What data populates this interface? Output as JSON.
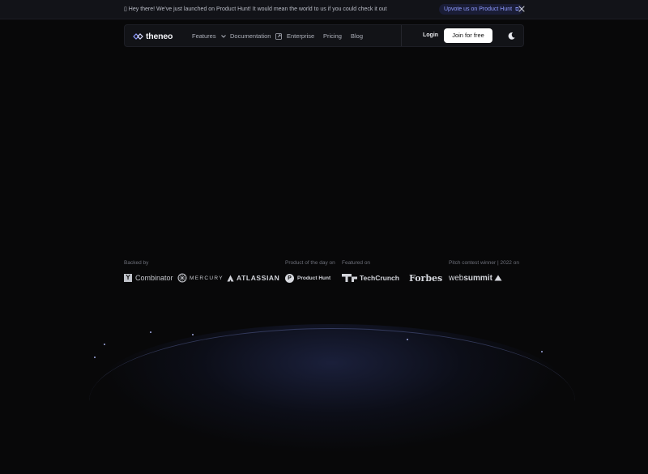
{
  "banner": {
    "text": "▯ Hey there! We've just launched on Product Hunt! It would mean the world to us if you could check it out",
    "cta_label": "Upvote us on Product Hunt",
    "close_icon": "close-icon"
  },
  "nav": {
    "logo_text": "theneo",
    "items": [
      "Features",
      "Documentation",
      "Enterprise",
      "Pricing",
      "Blog"
    ],
    "login_label": "Login",
    "join_label": "Join for free",
    "theme_icon": "moon-icon"
  },
  "colors": {
    "background": "#080809",
    "accent": "#8f9bff",
    "join_button": "#ffffff"
  },
  "social_proof": {
    "backed_by": "Backed by",
    "product_of_day": "Product of the day on",
    "featured_on": "Featured on",
    "pitch_winner": "Pitch contest winner | 2022 on",
    "brands": {
      "ycombinator": "Combinator",
      "ycombinator_mark": "Y",
      "mercury": "MERCURY",
      "atlassian": "ATLASSIAN",
      "producthunt": "Product Hunt",
      "producthunt_mark": "P",
      "techcrunch": "TechCrunch",
      "forbes": "Forbes",
      "websummit_web": "web",
      "websummit_summit": "summit"
    }
  }
}
